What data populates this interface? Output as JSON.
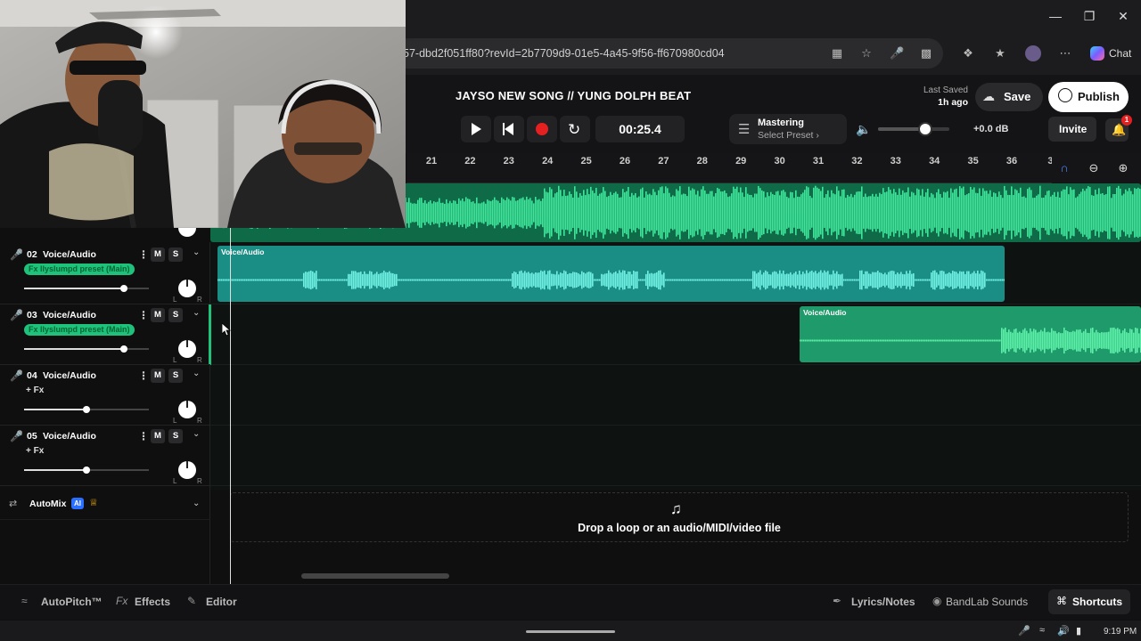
{
  "browser": {
    "url": "57-dbd2f051ff80?revId=2b7709d9-01e5-4a45-9f56-ff670980cd04",
    "chat_label": "Chat",
    "window_controls": [
      "minimize-icon",
      "restore-icon",
      "close-icon"
    ]
  },
  "header": {
    "song_title": "JAYSO NEW SONG // YUNG DOLPH BEAT",
    "last_saved_label": "Last Saved",
    "last_saved_time": "1h ago",
    "save_label": "Save",
    "publish_label": "Publish",
    "time": "00:25.4",
    "mastering_label": "Mastering",
    "mastering_preset": "Select Preset ›",
    "volume_level": 0.66,
    "db_readout": "+0.0 dB",
    "invite_label": "Invite",
    "notification_count": "1"
  },
  "ruler": {
    "ticks": [
      "21",
      "22",
      "23",
      "24",
      "25",
      "26",
      "27",
      "28",
      "29",
      "30",
      "31",
      "32",
      "33",
      "34",
      "35",
      "36",
      "3"
    ]
  },
  "tracks": [
    {
      "number": "02",
      "name": "Voice/Audio",
      "fx": "Fx llyslumpd preset (Main)",
      "fx_active": true,
      "volume": 0.8,
      "mic_color": "#1fc27a",
      "clip_label": "Voice/Audio"
    },
    {
      "number": "03",
      "name": "Voice/Audio",
      "fx": "Fx llyslumpd preset (Main)",
      "fx_active": true,
      "volume": 0.8,
      "mic_color": "#1fc27a",
      "clip_label": "Voice/Audio"
    },
    {
      "number": "04",
      "name": "Voice/Audio",
      "fx": "+ Fx",
      "fx_active": false,
      "volume": 0.5,
      "mic_color": "#e8622a"
    },
    {
      "number": "05",
      "name": "Voice/Audio",
      "fx": "+ Fx",
      "fx_active": false,
      "volume": 0.5,
      "mic_color": "#d8303a"
    }
  ],
  "track_buttons": {
    "mute": "M",
    "solo": "S",
    "pan_left": "L",
    "pan_right": "R"
  },
  "automix": {
    "label": "AutoMix",
    "ai_badge": "AI"
  },
  "dropzone": {
    "text": "Drop a loop or an audio/MIDI/video file"
  },
  "bottom_bar": {
    "autopitch": "AutoPitch™",
    "effects": "Effects",
    "editor": "Editor",
    "lyrics": "Lyrics/Notes",
    "sounds": "BandLab Sounds",
    "shortcuts": "Shortcuts"
  },
  "taskbar": {
    "clock": "9:19 PM"
  },
  "colors": {
    "clip_green": "#1fc27a",
    "clip_teal": "#1d9a8a",
    "record_red": "#e62020",
    "accent_blue": "#2a6fff"
  }
}
